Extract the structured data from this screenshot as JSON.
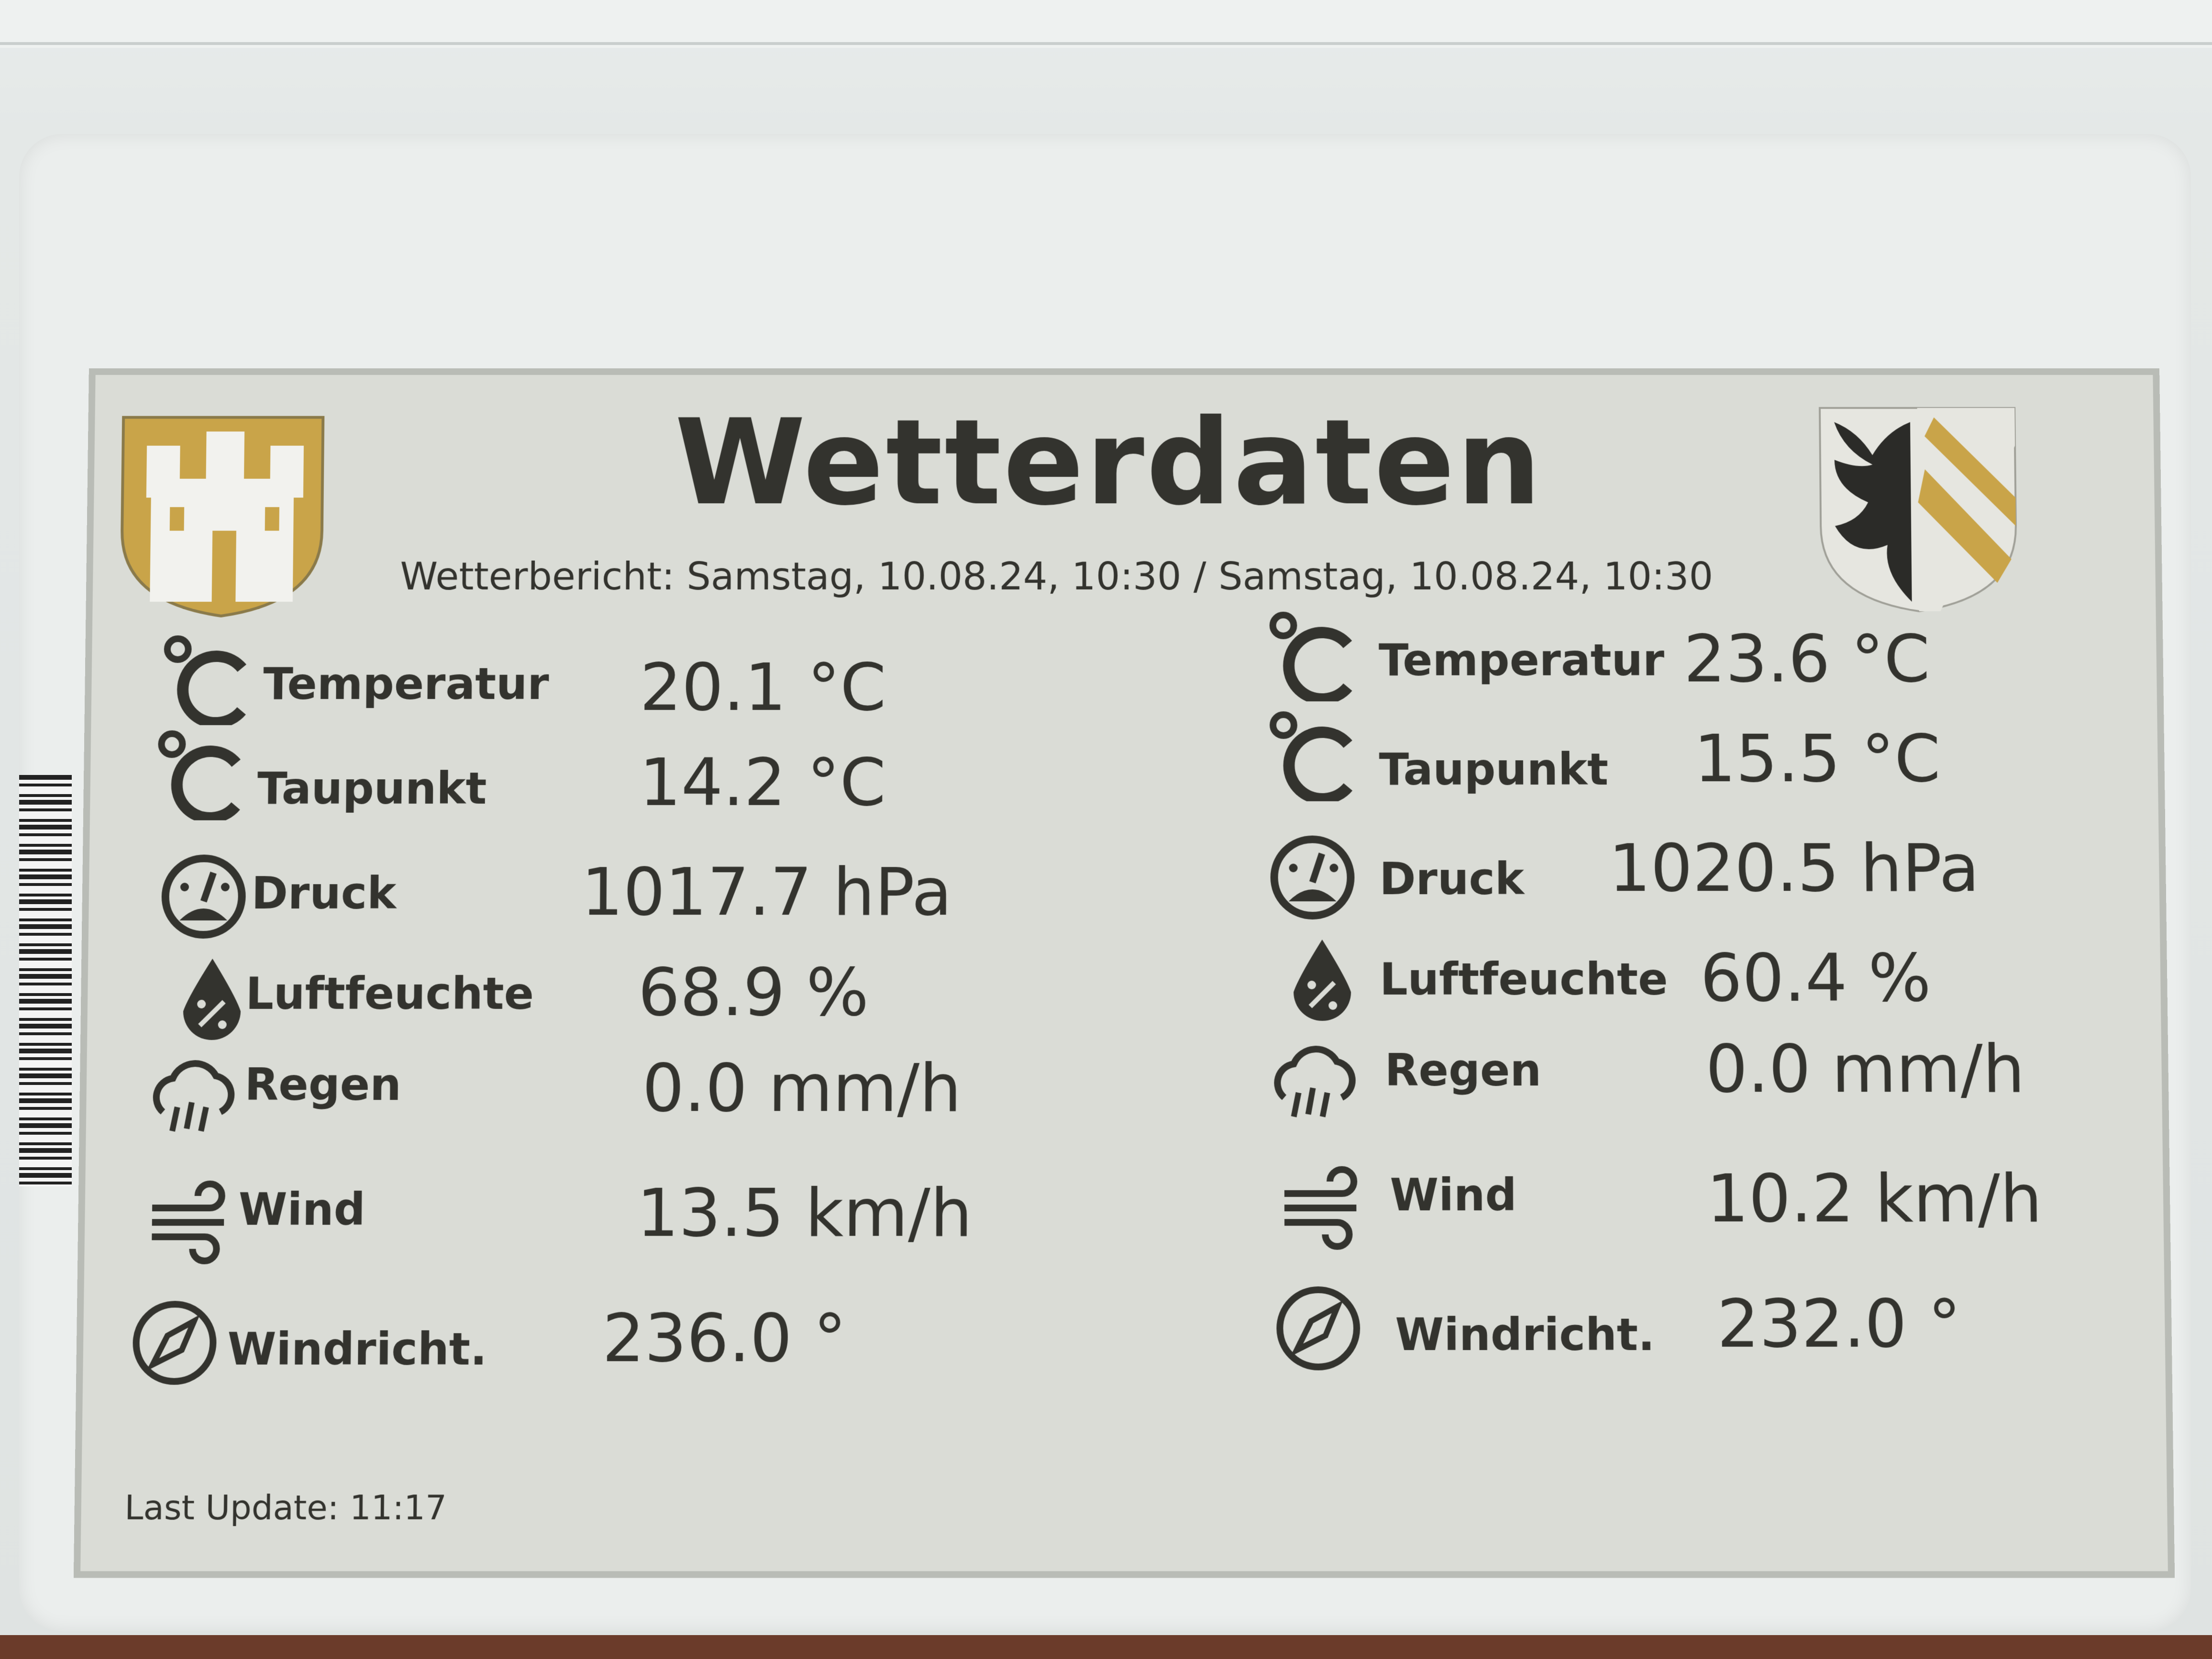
{
  "title": "Wetterdaten",
  "subtitle": "Wetterbericht: Samstag, 10.08.24, 10:30 / Samstag, 10.08.24, 10:30",
  "last_update": "Last Update: 11:17",
  "colors": {
    "ink": "#33332e",
    "paper": "#dadcd6",
    "accent": "#c9a449"
  },
  "crests": {
    "left": "castle-crest",
    "right": "eagle-crest"
  },
  "left": {
    "rows": [
      {
        "icon": "celsius-icon",
        "label": "Temperatur",
        "value": "20.1 °C"
      },
      {
        "icon": "celsius-icon",
        "label": "Taupunkt",
        "value": "14.2 °C"
      },
      {
        "icon": "gauge-icon",
        "label": "Druck",
        "value": "1017.7 hPa"
      },
      {
        "icon": "humidity-drop-icon",
        "label": "Luftfeuchte",
        "value": "68.9 %"
      },
      {
        "icon": "rain-cloud-icon",
        "label": "Regen",
        "value": "0.0 mm/h"
      },
      {
        "icon": "wind-icon",
        "label": "Wind",
        "value": "13.5 km/h"
      },
      {
        "icon": "compass-icon",
        "label": "Windricht.",
        "value": "236.0 °"
      }
    ]
  },
  "right": {
    "rows": [
      {
        "icon": "celsius-icon",
        "label": "Temperatur",
        "value": "23.6 °C"
      },
      {
        "icon": "celsius-icon",
        "label": "Taupunkt",
        "value": "15.5 °C"
      },
      {
        "icon": "gauge-icon",
        "label": "Druck",
        "value": "1020.5 hPa"
      },
      {
        "icon": "humidity-drop-icon",
        "label": "Luftfeuchte",
        "value": "60.4 %"
      },
      {
        "icon": "rain-cloud-icon",
        "label": "Regen",
        "value": "0.0 mm/h"
      },
      {
        "icon": "wind-icon",
        "label": "Wind",
        "value": "10.2 km/h"
      },
      {
        "icon": "compass-icon",
        "label": "Windricht.",
        "value": "232.0 °"
      }
    ]
  }
}
